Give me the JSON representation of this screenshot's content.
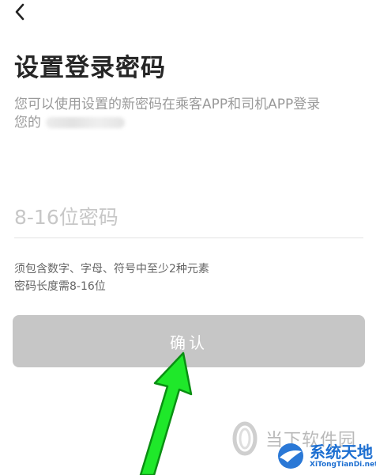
{
  "header": {
    "back_icon": "chevron-left-icon"
  },
  "page": {
    "title": "设置登录密码",
    "description_line1": "您可以使用设置的新密码在乘客APP和司机APP登录",
    "description_line2_prefix": "您的"
  },
  "password": {
    "placeholder": "8-16位密码",
    "value": ""
  },
  "hints": [
    "须包含数字、字母、符号中至少2种元素",
    "密码长度需8-16位"
  ],
  "confirm": {
    "label": "确认"
  },
  "watermarks": {
    "site1": "当下软件园",
    "site2_cn": "系统天地",
    "site2_en": "XiTongTianDi.net"
  },
  "colors": {
    "button_disabled": "#c6c6c6",
    "arrow": "#1fe82a",
    "watermark_blue": "#1d6fd1"
  }
}
